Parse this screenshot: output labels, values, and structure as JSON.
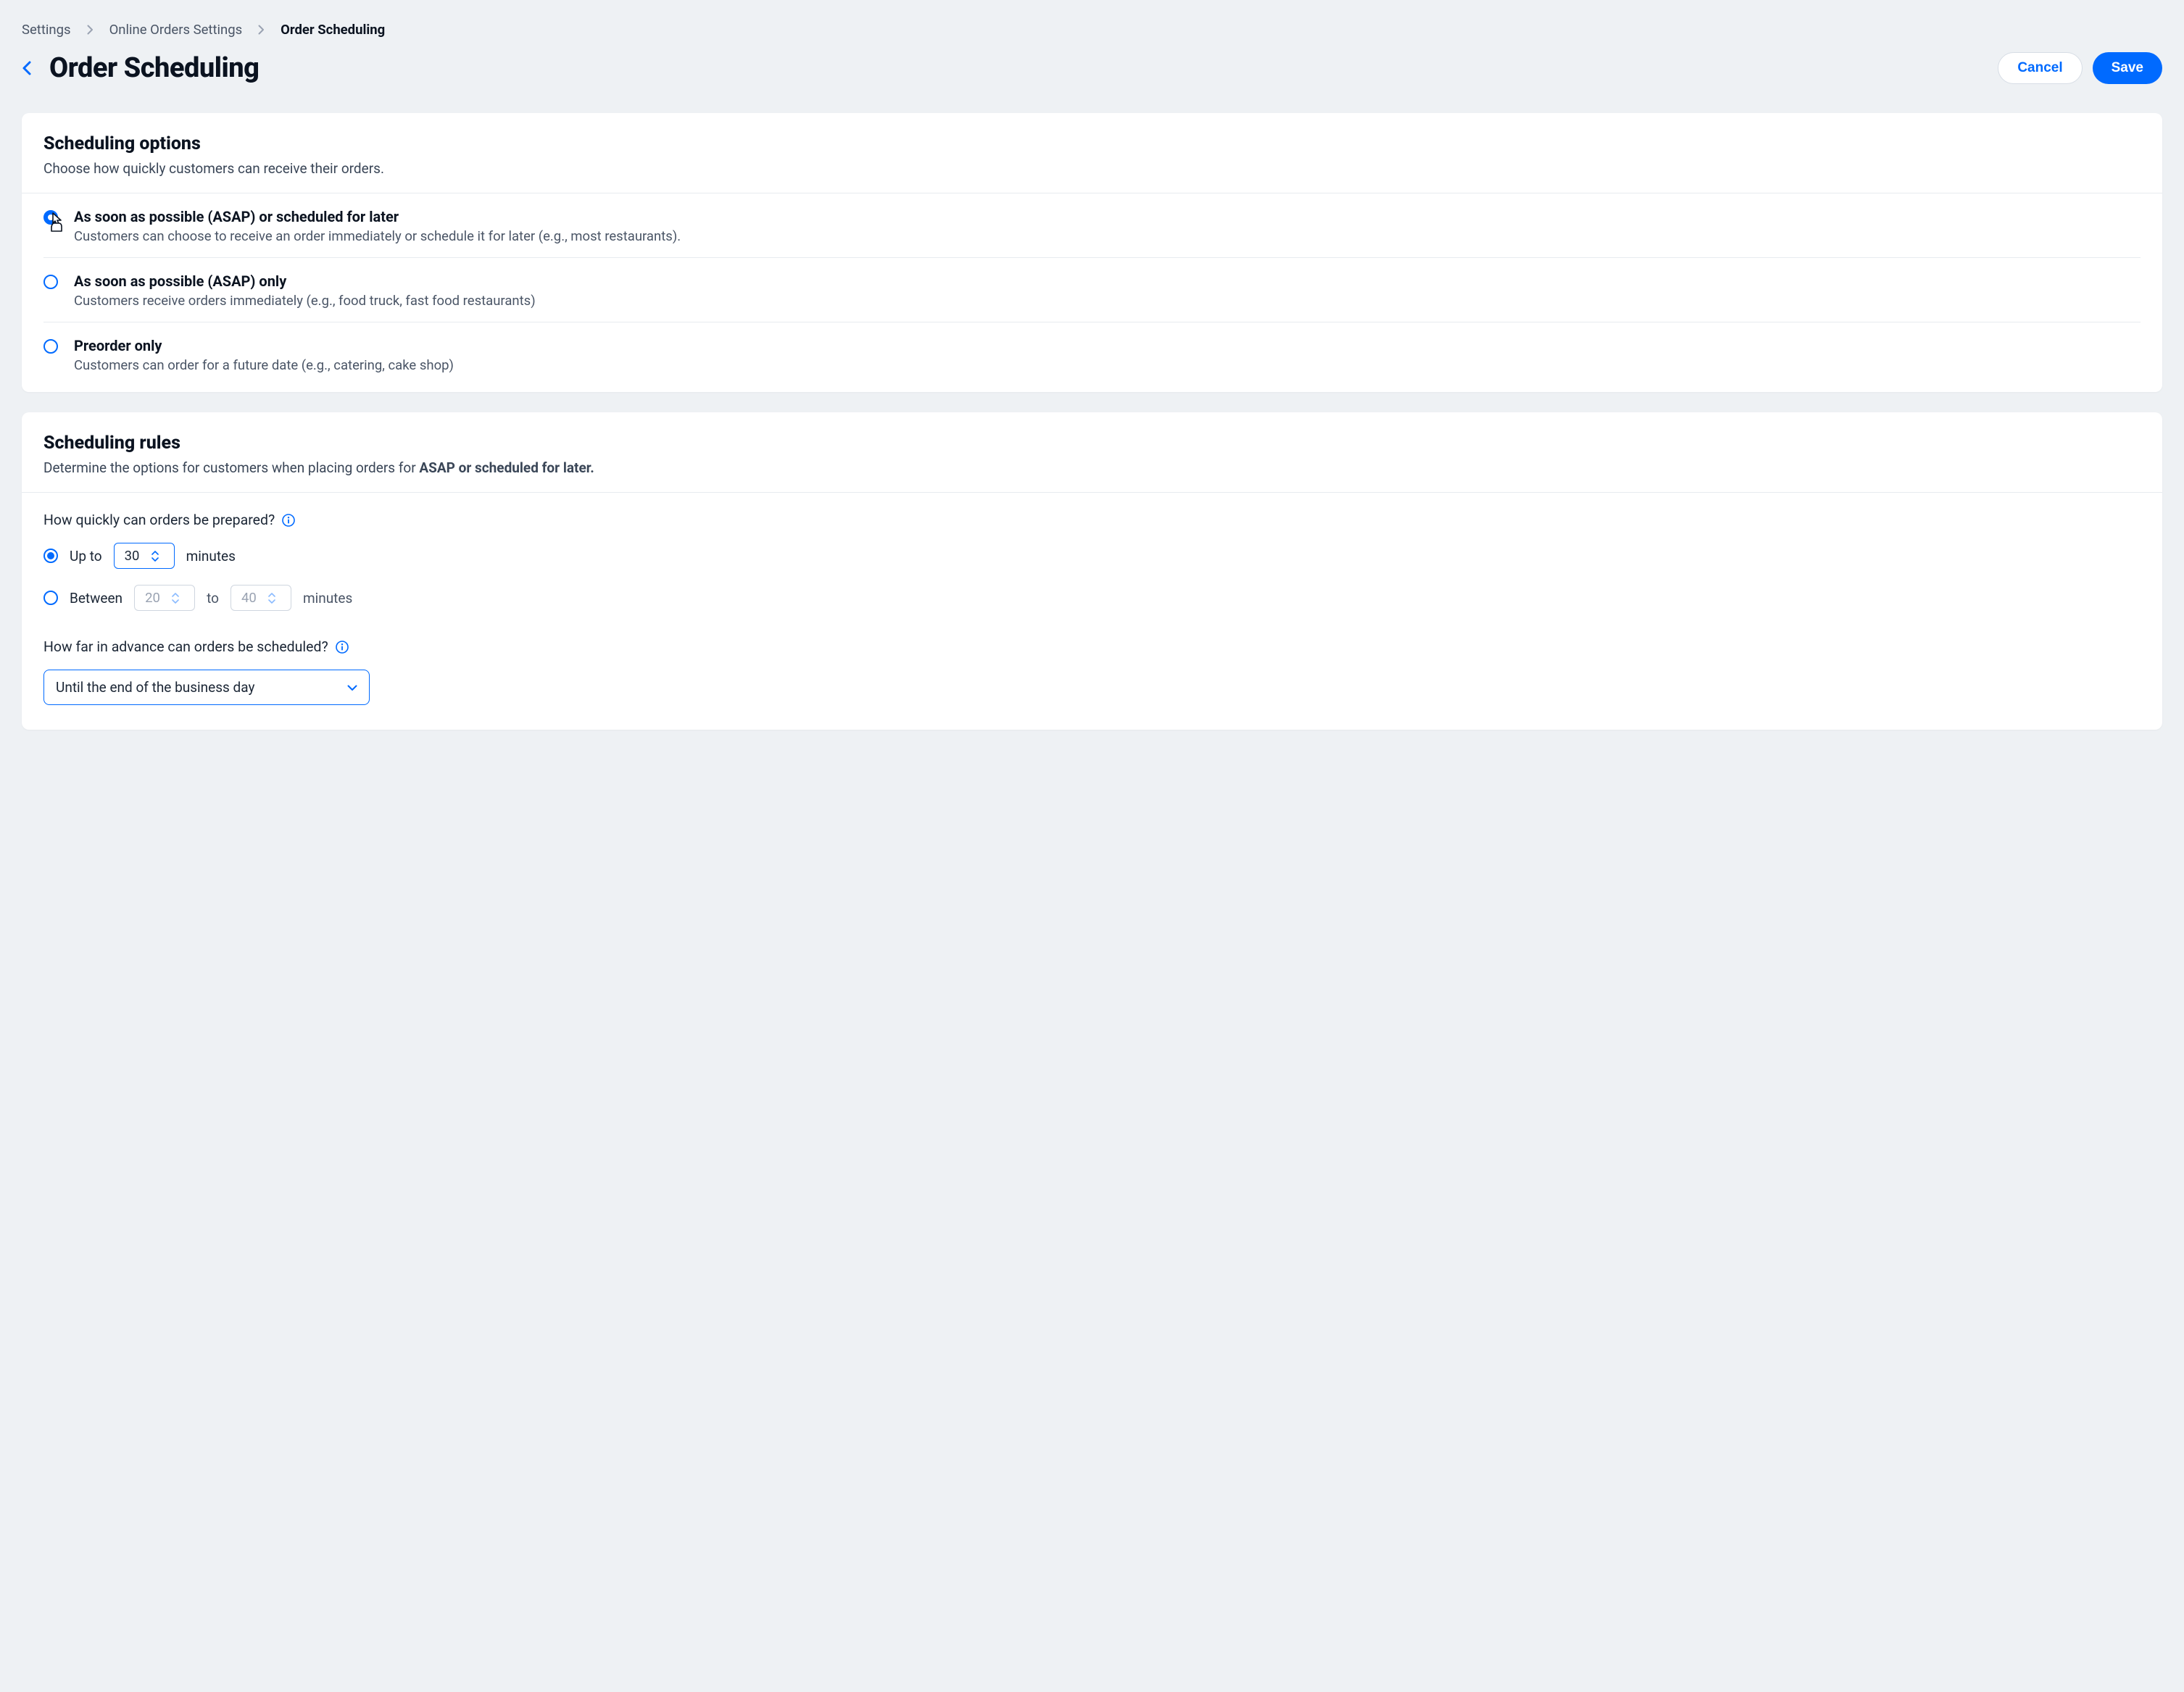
{
  "breadcrumb": {
    "items": [
      "Settings",
      "Online Orders Settings",
      "Order Scheduling"
    ]
  },
  "page": {
    "title": "Order Scheduling",
    "cancel": "Cancel",
    "save": "Save"
  },
  "scheduling_options": {
    "title": "Scheduling options",
    "subtitle": "Choose how quickly customers can receive their orders.",
    "options": [
      {
        "title": "As soon as possible (ASAP) or scheduled for later",
        "desc": "Customers can choose to receive an order immediately or schedule it for later (e.g., most restaurants)."
      },
      {
        "title": "As soon as possible (ASAP)  only",
        "desc": "Customers receive orders immediately (e.g., food truck, fast food restaurants)"
      },
      {
        "title": "Preorder only",
        "desc": "Customers can order for a future date (e.g., catering, cake shop)"
      }
    ]
  },
  "scheduling_rules": {
    "title": "Scheduling rules",
    "subtitle_prefix": "Determine the options for customers when placing orders for ",
    "subtitle_bold": "ASAP or scheduled for later.",
    "prep": {
      "label": "How quickly can orders be prepared?",
      "upto_label": "Up to",
      "upto_value": "30",
      "minutes": "minutes",
      "between_label": "Between",
      "between_low": "20",
      "to": "to",
      "between_high": "40"
    },
    "advance": {
      "label": "How far in advance can orders be scheduled?",
      "value": "Until the end of the business day"
    }
  }
}
